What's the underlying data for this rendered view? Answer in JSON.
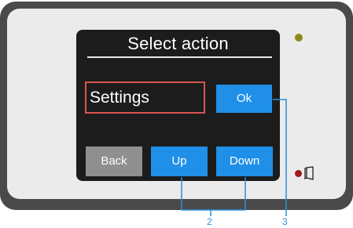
{
  "screen": {
    "title": "Select action",
    "selected_item": "Settings",
    "buttons": {
      "ok": "Ok",
      "back": "Back",
      "up": "Up",
      "down": "Down"
    }
  },
  "callouts": {
    "label_2": "2",
    "label_3": "3"
  },
  "colors": {
    "bezel": "#4a4a4a",
    "panel": "#ebebeb",
    "screen": "#1c1c1c",
    "button_blue": "#1f8fe8",
    "button_gray": "#8f8f8f",
    "selection_border": "#d9534f",
    "callout": "#2b8fd9"
  },
  "icons": [
    "led-indicator",
    "door-icon"
  ]
}
